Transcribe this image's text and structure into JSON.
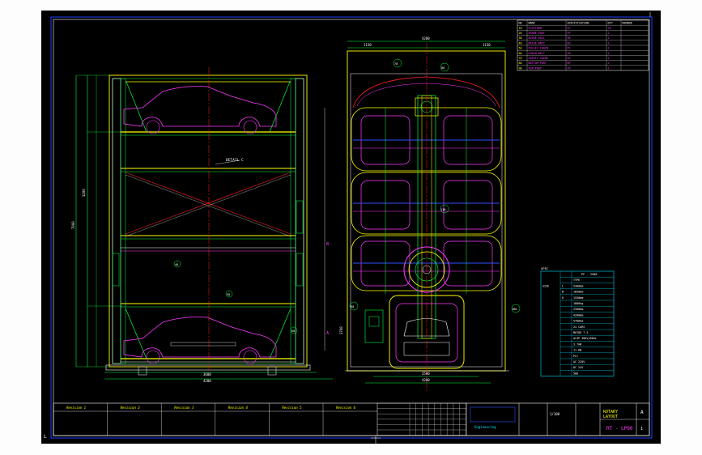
{
  "colors": {
    "background": "#000000",
    "frame": "#ffffff",
    "border": "#1e40ff",
    "yellow": "#ffff00",
    "green": "#00ff3c",
    "magenta": "#ff3cff",
    "red": "#ff2020",
    "cyan": "#00e5ff",
    "blue": "#3050ff",
    "white": "#ffffff"
  },
  "labels": {
    "detail": "DETAIL C",
    "callout_1": "40",
    "callout_2": "50",
    "callout_3": "60",
    "callout_4": "70",
    "callout_5": "80",
    "callout_6": "90",
    "callout_7": "100",
    "callout_8": "110",
    "section_mark_a": "A",
    "section_mark_b": "B",
    "left_marker": "L"
  },
  "dimensions": {
    "left_bottom_1": "3600",
    "left_bottom_2": "4200",
    "left_vertical_1": "3200",
    "left_vertical_2": "7000",
    "right_top_1": "4200",
    "right_top_2": "1150",
    "right_top_3": "1150",
    "right_bottom_1": "2500",
    "right_bottom_2": "4200",
    "right_side": "3700"
  },
  "parts_table": {
    "headers": [
      "NO",
      "NAME",
      "SPECIFICATION",
      "QTY",
      "REMARK"
    ],
    "rows": [
      [
        "10",
        "PLATFORM",
        "PL",
        "24",
        ""
      ],
      [
        "20",
        "FRAME PART",
        "FP",
        "2",
        ""
      ],
      [
        "30",
        "GUIDE RAIL",
        "GR",
        "2",
        ""
      ],
      [
        "40",
        "DRIVE UNIT",
        "DU",
        "2",
        ""
      ],
      [
        "50",
        "PULLEY CHAIN",
        "PC",
        "2",
        ""
      ],
      [
        "60",
        "CHAIN BELT",
        "CB",
        "2",
        ""
      ],
      [
        "70",
        "SAFETY GUIDE",
        "SG",
        "2",
        ""
      ],
      [
        "80",
        "BOTTOM PART",
        "BP",
        "2",
        ""
      ],
      [
        "90",
        "TOP PART",
        "TP",
        "1",
        ""
      ]
    ]
  },
  "spec_table": {
    "title": "SPEC",
    "header_right": "PF - 2500",
    "rows": [
      [
        "",
        "",
        "TYPE"
      ],
      [
        "SIZE",
        "L",
        "5300mm"
      ],
      [
        "",
        "W",
        "1850mm"
      ],
      [
        "",
        "H",
        "1550mm"
      ],
      [
        "",
        "",
        "1800kg"
      ],
      [
        "",
        "",
        "2500mm"
      ],
      [
        "",
        "",
        "4200mm"
      ],
      [
        "",
        "",
        "5700mm"
      ],
      [
        "",
        "",
        "24 CARS"
      ],
      [
        "",
        "",
        "MOTOR 7.5"
      ],
      [
        "",
        "",
        "AC3P 380V/60Hz"
      ],
      [
        "",
        "",
        "3.7kW"
      ],
      [
        "",
        "",
        "11 KW"
      ],
      [
        "",
        "",
        "PLC"
      ],
      [
        "",
        "",
        "AC 220V"
      ],
      [
        "",
        "",
        "DC 24V"
      ],
      [
        "",
        "",
        "500"
      ]
    ]
  },
  "revisions": [
    "Revision 1",
    "Revision 2",
    "Revision 3",
    "Revision 4",
    "Revision 5",
    "Revision 6"
  ],
  "title_block": {
    "project": "ROTARY",
    "title": "LAYOUT",
    "drawing_no": "RT - LP00",
    "scale": "1/100",
    "sheet": "1",
    "rev": "A",
    "company": "Engineering"
  }
}
